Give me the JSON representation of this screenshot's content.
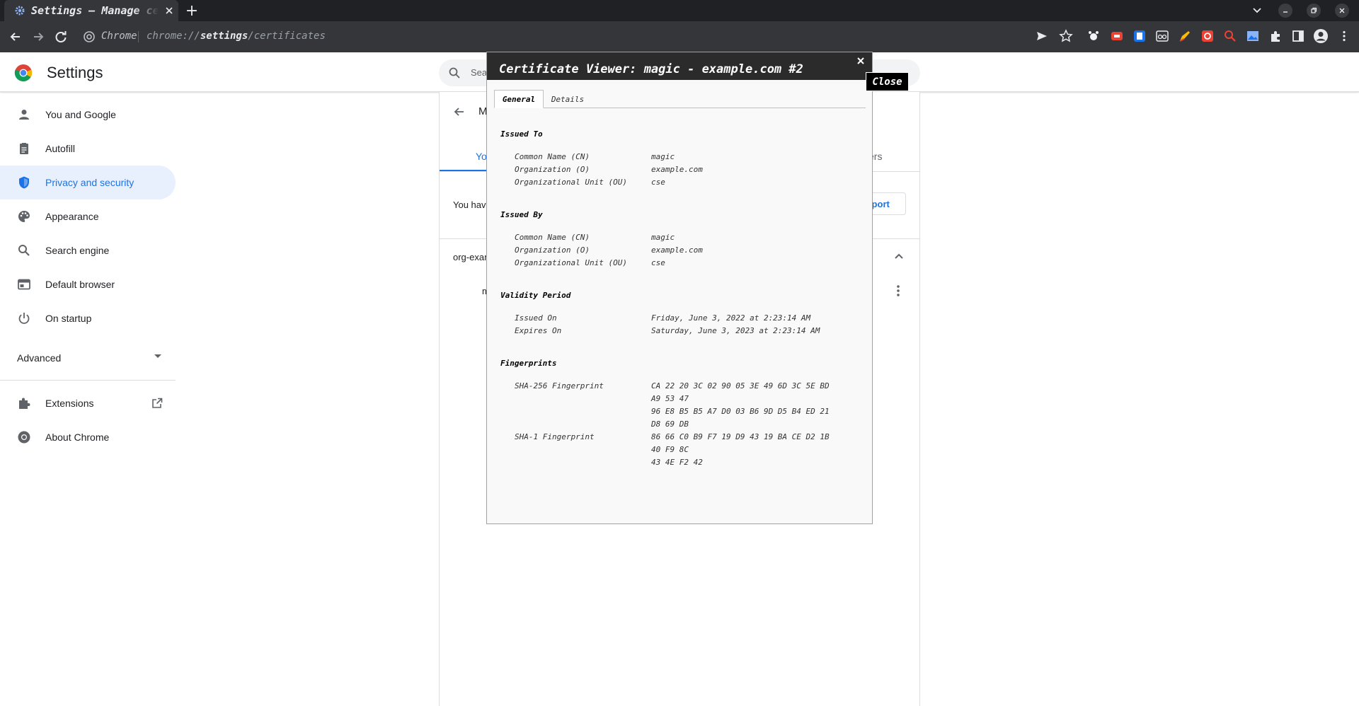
{
  "browser": {
    "tab_title": "Settings – Manage certificates",
    "new_tab_label": "+",
    "chip_label": "Chrome",
    "url_scheme": "chrome://",
    "url_host": "settings",
    "url_path": "/certificates"
  },
  "settings": {
    "title": "Settings",
    "search_placeholder": "Search settings",
    "sidebar": {
      "items": [
        {
          "label": "You and Google",
          "icon": "person-icon"
        },
        {
          "label": "Autofill",
          "icon": "clipboard-icon"
        },
        {
          "label": "Privacy and security",
          "icon": "shield-icon",
          "active": true
        },
        {
          "label": "Appearance",
          "icon": "palette-icon"
        },
        {
          "label": "Search engine",
          "icon": "search-icon"
        },
        {
          "label": "Default browser",
          "icon": "browser-icon"
        },
        {
          "label": "On startup",
          "icon": "power-icon"
        }
      ],
      "advanced_label": "Advanced",
      "extensions_label": "Extensions",
      "about_label": "About Chrome"
    },
    "page": {
      "back_label": "M",
      "tab_yours": "Yo",
      "tab_others": "ers",
      "info_text": "You have",
      "import_label": "mport",
      "group_label": "org-exam",
      "cert_row_initial": "m"
    }
  },
  "dialog": {
    "title": "Certificate Viewer: magic - example.com #2",
    "close_tooltip": "Close",
    "tabs": [
      "General",
      "Details"
    ],
    "issued_to": {
      "heading": "Issued To",
      "fields": [
        {
          "label": "Common Name (CN)",
          "value": "magic"
        },
        {
          "label": "Organization (O)",
          "value": "example.com"
        },
        {
          "label": "Organizational Unit (OU)",
          "value": "cse"
        }
      ]
    },
    "issued_by": {
      "heading": "Issued By",
      "fields": [
        {
          "label": "Common Name (CN)",
          "value": "magic"
        },
        {
          "label": "Organization (O)",
          "value": "example.com"
        },
        {
          "label": "Organizational Unit (OU)",
          "value": "cse"
        }
      ]
    },
    "validity": {
      "heading": "Validity Period",
      "fields": [
        {
          "label": "Issued On",
          "value": "Friday, June 3, 2022 at 2:23:14 AM"
        },
        {
          "label": "Expires On",
          "value": "Saturday, June 3, 2023 at 2:23:14 AM"
        }
      ]
    },
    "fingerprints": {
      "heading": "Fingerprints",
      "sha256_label": "SHA-256 Fingerprint",
      "sha256_lines": [
        "CA 22 20 3C 02 90 05 3E 49 6D 3C 5E BD",
        "A9 53 47",
        "96 E8 B5 B5 A7 D0 03 B6 9D D5 B4 ED 21",
        "D8 69 DB"
      ],
      "sha1_label": "SHA-1 Fingerprint",
      "sha1_lines": [
        "86 66 C0 B9 F7 19 D9 43 19 BA CE D2 1B",
        "40 F9 8C",
        "43 4E F2 42"
      ]
    }
  }
}
